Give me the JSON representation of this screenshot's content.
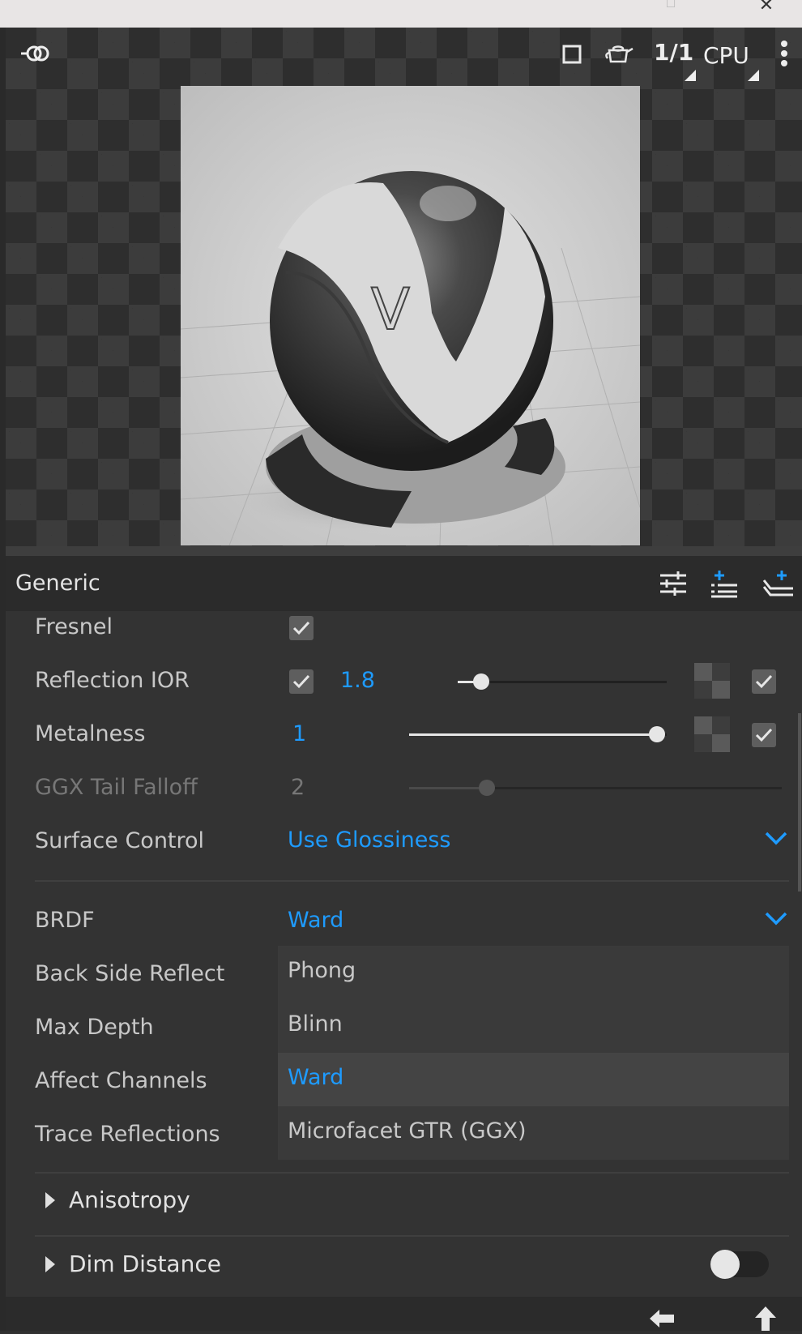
{
  "toolbar": {
    "resolution_label": "1/1",
    "engine_label": "CPU"
  },
  "panel": {
    "title": "Generic"
  },
  "properties": {
    "fresnel": {
      "label": "Fresnel",
      "checked": true
    },
    "reflection_ior": {
      "label": "Reflection IOR",
      "checked": true,
      "value": "1.8",
      "slider_fraction": 0.06,
      "map_enabled": true
    },
    "metalness": {
      "label": "Metalness",
      "value": "1",
      "slider_fraction": 1.0,
      "map_enabled": true
    },
    "ggx_tail_falloff": {
      "label": "GGX Tail Falloff",
      "value": "2",
      "slider_fraction": 0.2
    },
    "surface_control": {
      "label": "Surface Control",
      "value": "Use Glossiness"
    },
    "brdf": {
      "label": "BRDF",
      "value": "Ward"
    },
    "back_side_reflect": {
      "label": "Back Side Reflect"
    },
    "max_depth": {
      "label": "Max Depth"
    },
    "affect_channels": {
      "label": "Affect Channels"
    },
    "trace_reflections": {
      "label": "Trace Reflections"
    }
  },
  "brdf_dropdown": {
    "options": [
      "Phong",
      "Blinn",
      "Ward",
      "Microfacet GTR (GGX)"
    ],
    "selected": "Ward"
  },
  "sections": {
    "anisotropy": "Anisotropy",
    "dim_distance": {
      "label": "Dim Distance",
      "enabled": false
    }
  },
  "colors": {
    "accent": "#1e9bff",
    "panel_bg": "#333333",
    "header_bg": "#2b2b2b"
  }
}
